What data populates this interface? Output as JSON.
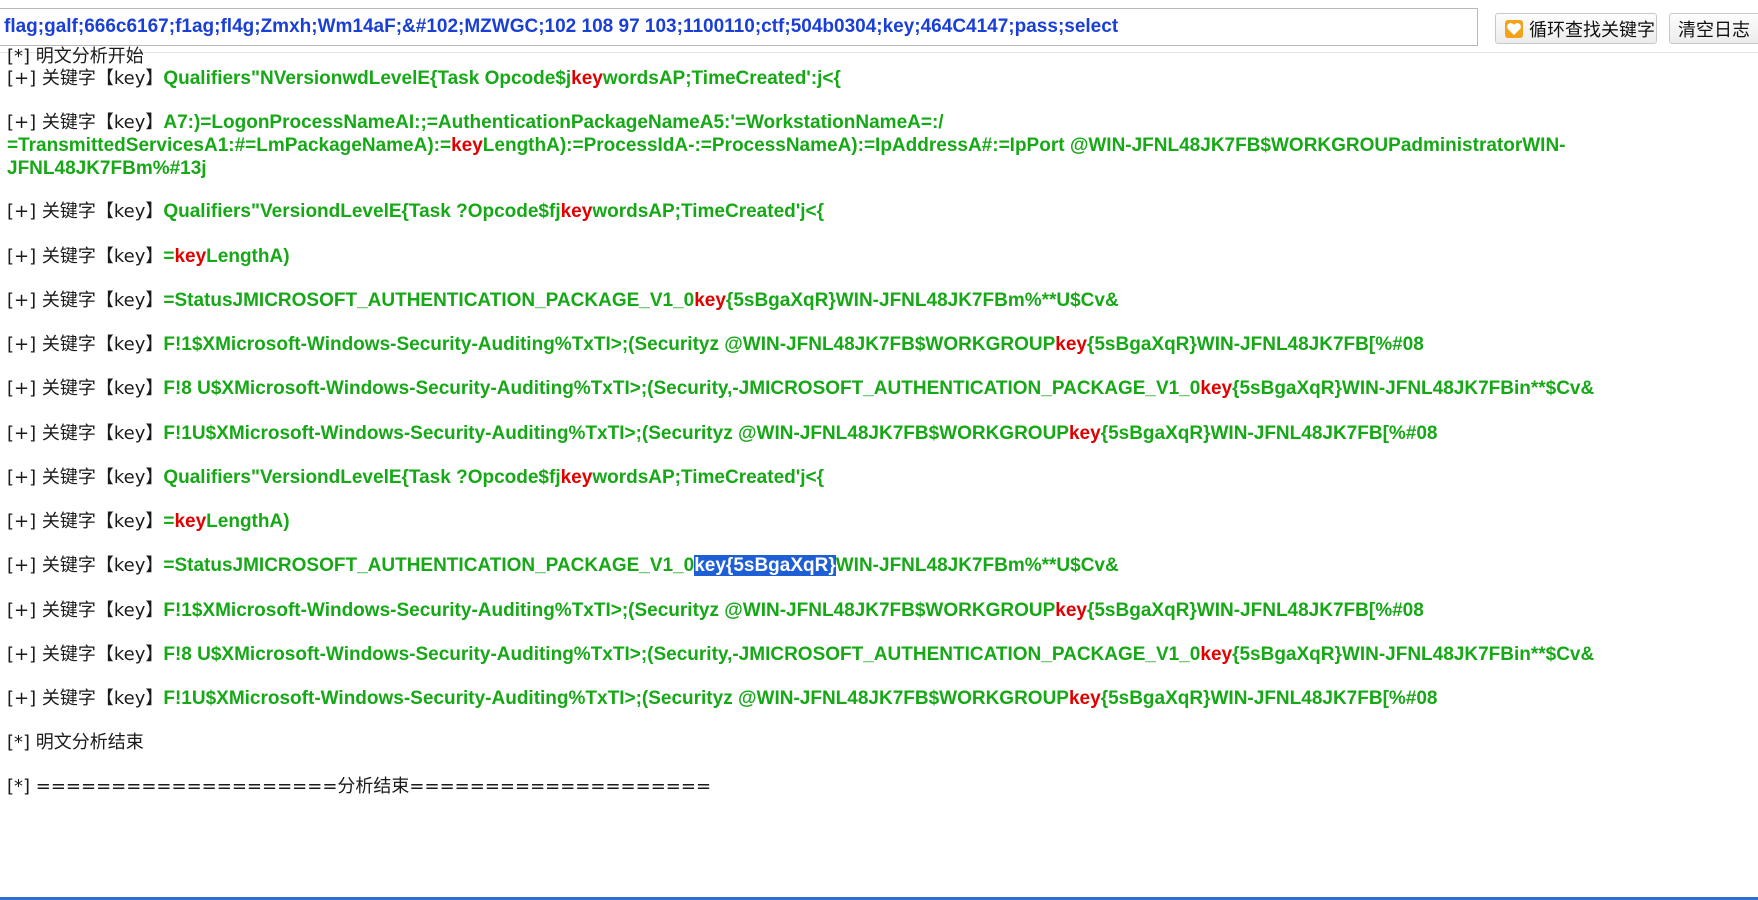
{
  "toolbar": {
    "search_value": "flag;galf;666c6167;f1ag;fl4g;Zmxh;Wm14aF;&#102;MZWGC;102 108 97 103;1100110;ctf;504b0304;key;464C4147;pass;select",
    "loop_button_label": "循环查找关键字",
    "loop_button_icon": "heart-icon",
    "clear_button_label": "清空日志"
  },
  "colors": {
    "matched_text": "#17a817",
    "keyword_highlight": "#e00000",
    "input_text": "#1a3fd6",
    "selection_bg": "#1e5fd6"
  },
  "log": {
    "start_line": "[*] 明文分析开始",
    "prefix": "[+] 关键字【key】",
    "entries": [
      {
        "pre": "Qualifiers\"NVersionwdLevelE{Task Opcode$j",
        "kw": "key",
        "post": "wordsAP;TimeCreated':j<{"
      },
      {
        "pre": "A7:)=LogonProcessNameAI:;=AuthenticationPackageNameA5:'=WorkstationNameA=:/",
        "line2_pre": "=TransmittedServicesA1:#=LmPackageNameA):=",
        "kw": "key",
        "post": "LengthA):=ProcessIdA-:=ProcessNameA):=IpAddressA#:=IpPort @WIN-JFNL48JK7FB$WORKGROUPadministratorWIN-",
        "line3": "JFNL48JK7FBm%#13j"
      },
      {
        "pre": "Qualifiers\"VersiondLevelE{Task ?Opcode$fj",
        "kw": "key",
        "post": "wordsAP;TimeCreated'j<{"
      },
      {
        "pre": "=",
        "kw": "key",
        "post": "LengthA)"
      },
      {
        "pre": "=StatusJMICROSOFT_AUTHENTICATION_PACKAGE_V1_0",
        "kw": "key",
        "post": "{5sBgaXqR}WIN-JFNL48JK7FBm%**U$Cv&"
      },
      {
        "pre": "F!1$XMicrosoft-Windows-Security-Auditing%TxTI>;(Securityz @WIN-JFNL48JK7FB$WORKGROUP",
        "kw": "key",
        "post": "{5sBgaXqR}WIN-JFNL48JK7FB[%#08"
      },
      {
        "pre": "F!8 U$XMicrosoft-Windows-Security-Auditing%TxTI>;(Security,-JMICROSOFT_AUTHENTICATION_PACKAGE_V1_0",
        "kw": "key",
        "post": "{5sBgaXqR}WIN-JFNL48JK7FBin**$Cv&"
      },
      {
        "pre": "F!1U$XMicrosoft-Windows-Security-Auditing%TxTI>;(Securityz @WIN-JFNL48JK7FB$WORKGROUP",
        "kw": "key",
        "post": "{5sBgaXqR}WIN-JFNL48JK7FB[%#08"
      },
      {
        "pre": "Qualifiers\"VersiondLevelE{Task ?Opcode$fj",
        "kw": "key",
        "post": "wordsAP;TimeCreated'j<{"
      },
      {
        "pre": "=",
        "kw": "key",
        "post": "LengthA)"
      },
      {
        "pre": "=StatusJMICROSOFT_AUTHENTICATION_PACKAGE_V1_0",
        "kw": "key",
        "sel": "{5sBgaXqR}",
        "post": "WIN-JFNL48JK7FBm%**U$Cv&"
      },
      {
        "pre": "F!1$XMicrosoft-Windows-Security-Auditing%TxTI>;(Securityz @WIN-JFNL48JK7FB$WORKGROUP",
        "kw": "key",
        "post": "{5sBgaXqR}WIN-JFNL48JK7FB[%#08"
      },
      {
        "pre": "F!8 U$XMicrosoft-Windows-Security-Auditing%TxTI>;(Security,-JMICROSOFT_AUTHENTICATION_PACKAGE_V1_0",
        "kw": "key",
        "post": "{5sBgaXqR}WIN-JFNL48JK7FBin**$Cv&"
      },
      {
        "pre": "F!1U$XMicrosoft-Windows-Security-Auditing%TxTI>;(Securityz @WIN-JFNL48JK7FB$WORKGROUP",
        "kw": "key",
        "post": "{5sBgaXqR}WIN-JFNL48JK7FB[%#08"
      }
    ],
    "end_plain_line": "[*] 明文分析结束",
    "end_line": "[*] ====================分析结束===================="
  }
}
